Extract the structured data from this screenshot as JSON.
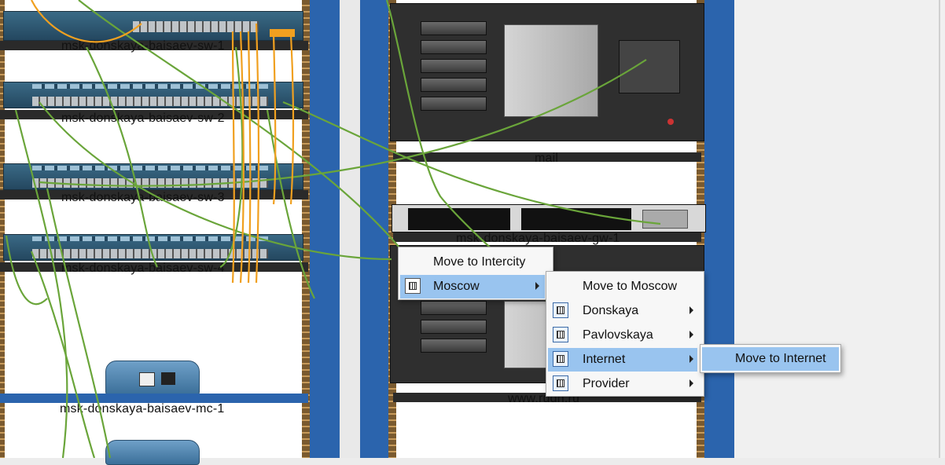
{
  "devices": {
    "sw1": "msk-donskaya-baisaev-sw-1",
    "sw2": "msk-donskaya-baisaev-sw-2",
    "sw3": "msk-donskaya-baisaev-sw-3",
    "sw4": "msk-donskaya-baisaev-sw-4",
    "mc1": "msk-donskaya-baisaev-mc-1",
    "mail": "mail",
    "gw1": "msk-donskaya-baisaev-gw-1",
    "www": "www.rudn.ru"
  },
  "menu1": {
    "items": [
      {
        "label": "Move to Intercity"
      },
      {
        "label": "Moscow",
        "icon": "building-icon",
        "submenu": true
      }
    ]
  },
  "menu2": {
    "items": [
      {
        "label": "Move to Moscow"
      },
      {
        "label": "Donskaya",
        "icon": "switch-icon",
        "submenu": true
      },
      {
        "label": "Pavlovskaya",
        "icon": "switch-icon",
        "submenu": true
      },
      {
        "label": "Internet",
        "icon": "switch-icon",
        "submenu": true
      },
      {
        "label": "Provider",
        "icon": "switch-icon",
        "submenu": true
      }
    ]
  },
  "menu3": {
    "items": [
      {
        "label": "Move to Internet"
      }
    ]
  },
  "colors": {
    "highlight": "#99c4ef",
    "cable_green": "#6aa53a",
    "cable_orange": "#f0a020",
    "pillar_blue": "#2b64ad"
  }
}
